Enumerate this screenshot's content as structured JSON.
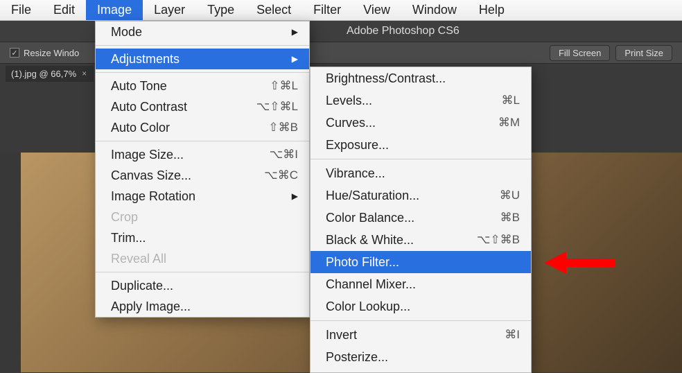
{
  "menubar": {
    "items": [
      "File",
      "Edit",
      "Image",
      "Layer",
      "Type",
      "Select",
      "Filter",
      "View",
      "Window",
      "Help"
    ],
    "active_index": 2
  },
  "app": {
    "title": "Adobe Photoshop CS6",
    "options_bar": {
      "checkbox_checked": true,
      "checkbox_label_truncated": "Resize Windo",
      "buttons": {
        "fill_screen": "Fill Screen",
        "print_size": "Print Size"
      }
    },
    "doc_tab": {
      "label": "(1).jpg @ 66,7%",
      "close_glyph": "×"
    }
  },
  "image_menu": {
    "mode": {
      "label": "Mode"
    },
    "adjustments": {
      "label": "Adjustments"
    },
    "auto_tone": {
      "label": "Auto Tone",
      "shortcut": "⇧⌘L"
    },
    "auto_contrast": {
      "label": "Auto Contrast",
      "shortcut": "⌥⇧⌘L"
    },
    "auto_color": {
      "label": "Auto Color",
      "shortcut": "⇧⌘B"
    },
    "image_size": {
      "label": "Image Size...",
      "shortcut": "⌥⌘I"
    },
    "canvas_size": {
      "label": "Canvas Size...",
      "shortcut": "⌥⌘C"
    },
    "image_rotation": {
      "label": "Image Rotation"
    },
    "crop": {
      "label": "Crop"
    },
    "trim": {
      "label": "Trim..."
    },
    "reveal_all": {
      "label": "Reveal All"
    },
    "duplicate": {
      "label": "Duplicate..."
    },
    "apply_image": {
      "label": "Apply Image..."
    }
  },
  "adjust_menu": {
    "brightness_contrast": {
      "label": "Brightness/Contrast..."
    },
    "levels": {
      "label": "Levels...",
      "shortcut": "⌘L"
    },
    "curves": {
      "label": "Curves...",
      "shortcut": "⌘M"
    },
    "exposure": {
      "label": "Exposure..."
    },
    "vibrance": {
      "label": "Vibrance..."
    },
    "hue_saturation": {
      "label": "Hue/Saturation...",
      "shortcut": "⌘U"
    },
    "color_balance": {
      "label": "Color Balance...",
      "shortcut": "⌘B"
    },
    "black_white": {
      "label": "Black & White...",
      "shortcut": "⌥⇧⌘B"
    },
    "photo_filter": {
      "label": "Photo Filter..."
    },
    "channel_mixer": {
      "label": "Channel Mixer..."
    },
    "color_lookup": {
      "label": "Color Lookup..."
    },
    "invert": {
      "label": "Invert",
      "shortcut": "⌘I"
    },
    "posterize": {
      "label": "Posterize..."
    }
  },
  "glyphs": {
    "submenu_arrow": "▶"
  },
  "annotation": {
    "arrow_target": "photo_filter"
  }
}
